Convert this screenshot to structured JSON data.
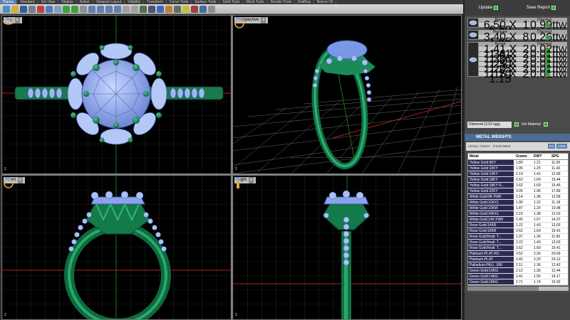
{
  "tabs": [
    "Planes",
    "Standard",
    "Set View",
    "Display",
    "Select",
    "Viewport Layout",
    "Visibility",
    "Transform",
    "Curve Tools",
    "Surface Tools",
    "Solid Tools",
    "Mesh Tools",
    "Render Tools",
    "Drafting",
    "New in V5"
  ],
  "viewports": {
    "top": {
      "label": "Top"
    },
    "perspective": {
      "label": "Perspective"
    },
    "front": {
      "label": "Front"
    },
    "right": {
      "label": "Right"
    },
    "axis_label": "z"
  },
  "panel": {
    "update_label": "Update",
    "save_report_label": "Save Report",
    "gems": [
      {
        "headers": [
          "Round",
          "",
          "Diamond"
        ],
        "rows": [
          {
            "size": "6.50 X 6.50",
            "qty": "1",
            "ct": "0.99ttw"
          }
        ]
      },
      {
        "headers": [
          "Marquise",
          "",
          "Diamond"
        ],
        "rows": [
          {
            "size": "3.40 X 1.65",
            "qty": "8",
            "ct": "0.26ttw"
          }
        ]
      },
      {
        "headers": [
          "Round",
          "",
          "Diamond"
        ],
        "rows": [
          {
            "size": "1.41 X 1.41",
            "qty": "2",
            "ct": "0.02ttw"
          },
          {
            "size": "1.36 X 1.36",
            "qty": "2",
            "ct": "0.01ttw"
          },
          {
            "size": "1.30 X 1.30",
            "qty": "2",
            "ct": "0.01ttw"
          },
          {
            "size": "1.25 X 1.25",
            "qty": "2",
            "ct": "0.01ttw"
          },
          {
            "size": "1.20 X 1.20",
            "qty": "2",
            "ct": "0.01ttw"
          },
          {
            "size": "1.15 X 1.15",
            "qty": "2",
            "ct": "0.01ttw"
          }
        ]
      }
    ],
    "material_select": "Diamond    (3.52 sgg)",
    "set_material_label": "Set Material",
    "metal_weights_title": "METAL WEIGHTS",
    "library_label": "Library: Classic - (Fast)-Metal",
    "btn_gs": "GS",
    "btn_clear": "Clear",
    "table_headers": [
      "Metal",
      "Grams",
      "DWT",
      "SPG"
    ],
    "metals": [
      [
        "Yellow Gold:9KY",
        "1.89",
        "1.21",
        "11.00"
      ],
      [
        "Yellow Gold:10KY",
        "1.95",
        "1.25",
        "11.43"
      ],
      [
        "Yellow Gold:14KY",
        "2.19",
        "1.41",
        "12.95"
      ],
      [
        "Yellow Gold:18KY",
        "2.62",
        "1.69",
        "15.44"
      ],
      [
        "Yellow Gold:18KY R...",
        "2.62",
        "1.69",
        "15.45"
      ],
      [
        "Yellow Gold:22KY",
        "3.05",
        "1.96",
        "17.89"
      ],
      [
        "White Gold:9K PdW",
        "2.14",
        "1.38",
        "12.58"
      ],
      [
        "White Gold:10KX1",
        "1.90",
        "1.22",
        "11.18"
      ],
      [
        "White Gold:10KW",
        "1.87",
        "1.20",
        "10.98"
      ],
      [
        "White Gold:14KX1",
        "2.15",
        "1.38",
        "12.62"
      ],
      [
        "White Gold:14K PdW",
        "2.45",
        "1.57",
        "14.37"
      ],
      [
        "Rose Gold:14KR",
        "2.22",
        "1.43",
        "13.03"
      ],
      [
        "Rose Gold:18KR",
        "2.62",
        "1.69",
        "15.41"
      ],
      [
        "Rose Gold:finali: T...",
        "1.97",
        "1.26",
        "11.56"
      ],
      [
        "Rose Gold:finali: T...",
        "2.22",
        "1.43",
        "13.03"
      ],
      [
        "Rose Gold:finali: T...",
        "2.62",
        "1.69",
        "15.41"
      ],
      [
        "Platinum:PLAT RU",
        "3.52",
        "2.26",
        "20.69"
      ],
      [
        "Platinum:PLAT",
        "3.42",
        "2.20",
        "20.12"
      ],
      [
        "Palladium:PALL .950",
        "2.11",
        "1.36",
        "12.42"
      ],
      [
        "Green Gold:10KG",
        "2.12",
        "1.36",
        "12.44"
      ],
      [
        "Green Gold:14KG",
        "2.41",
        "1.55",
        "14.17"
      ],
      [
        "Green Gold:18KG",
        "2.71",
        "1.74",
        "15.92"
      ]
    ]
  }
}
